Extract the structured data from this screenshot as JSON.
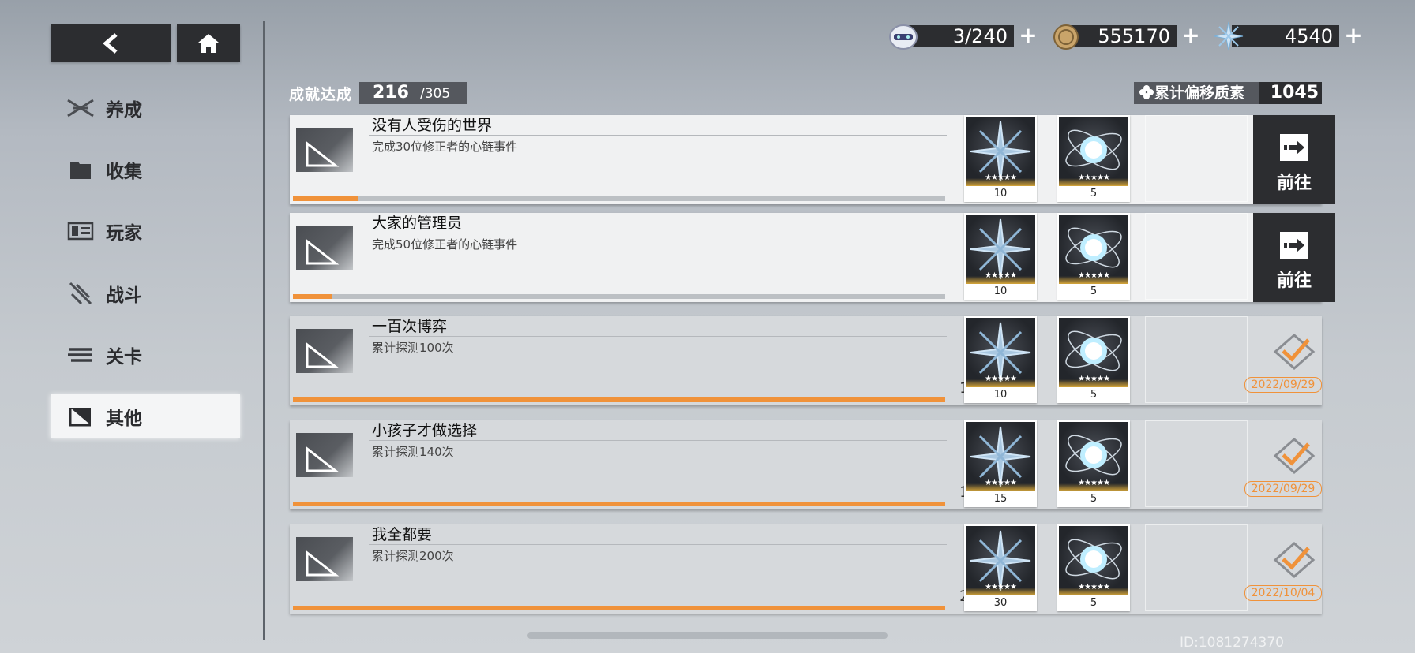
{
  "sidebar": {
    "items": [
      {
        "label": "养成",
        "icon": "crossed-swords-icon"
      },
      {
        "label": "收集",
        "icon": "folder-icon"
      },
      {
        "label": "玩家",
        "icon": "id-card-icon"
      },
      {
        "label": "战斗",
        "icon": "battle-icon"
      },
      {
        "label": "关卡",
        "icon": "stage-icon"
      },
      {
        "label": "其他",
        "icon": "other-icon",
        "active": true
      }
    ]
  },
  "currency": {
    "stamina": {
      "value": "3/240",
      "icon": "robot-head-icon"
    },
    "coins": {
      "value": "555170",
      "icon": "coin-icon"
    },
    "crystal": {
      "value": "4540",
      "icon": "crystal-icon"
    },
    "plus": "+"
  },
  "achievement": {
    "label": "成就达成",
    "count": "216",
    "total": "/305",
    "drift_label": "累计偏移质素",
    "drift_value": "1045"
  },
  "rows": [
    {
      "title": "没有人受伤的世界",
      "desc": "完成30位修正者的心链事件",
      "progress": "3/30",
      "fraction": 0.1,
      "rewards": [
        "10",
        "5"
      ],
      "action": "前往",
      "status": "open"
    },
    {
      "title": "大家的管理员",
      "desc": "完成50位修正者的心链事件",
      "progress": "3/50",
      "fraction": 0.06,
      "rewards": [
        "10",
        "5"
      ],
      "action": "前往",
      "status": "open"
    },
    {
      "title": "一百次博弈",
      "desc": "累计探测100次",
      "progress": "100/100",
      "fraction": 1.0,
      "rewards": [
        "10",
        "5"
      ],
      "date": "2022/09/29",
      "status": "done"
    },
    {
      "title": "小孩子才做选择",
      "desc": "累计探测140次",
      "progress": "140/140",
      "fraction": 1.0,
      "rewards": [
        "15",
        "5"
      ],
      "date": "2022/09/29",
      "status": "done"
    },
    {
      "title": "我全都要",
      "desc": "累计探测200次",
      "progress": "200/200",
      "fraction": 1.0,
      "rewards": [
        "30",
        "5"
      ],
      "date": "2022/10/04",
      "status": "done"
    }
  ],
  "reward_stars": "★★★★★",
  "footer": {
    "uid": "ID:1081274370"
  },
  "colors": {
    "accent": "#f0923a",
    "dark": "#2c2d30"
  }
}
